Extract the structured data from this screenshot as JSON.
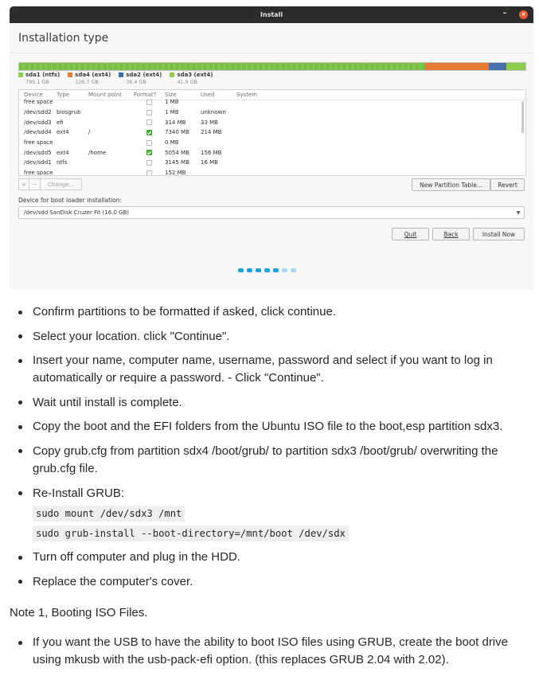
{
  "installer": {
    "window_title": "Install",
    "minimize_glyph": "–",
    "close_glyph": "×",
    "page_title": "Installation type",
    "usage_colors": {
      "green": "#77c043",
      "orange": "#e47c35",
      "blue": "#4a6fae",
      "lime": "#8ccd4c"
    },
    "legend": [
      {
        "name": "sda1 (ntfs)",
        "size": "795.1 GB",
        "color": "#8ccd4c"
      },
      {
        "name": "sda4 (ext4)",
        "size": "126.7 GB",
        "color": "#e47c35"
      },
      {
        "name": "sda2 (ext4)",
        "size": "36.4 GB",
        "color": "#3b6eb3"
      },
      {
        "name": "sda3 (ext4)",
        "size": "41.9 GB",
        "color": "#8ccd4c"
      }
    ],
    "columns": [
      "Device",
      "Type",
      "Mount point",
      "Format?",
      "Size",
      "Used",
      "System"
    ],
    "rows": [
      {
        "device": "free space",
        "type": "",
        "mount": "",
        "format": false,
        "size": "1 MB",
        "used": "",
        "system": ""
      },
      {
        "device": "/dev/sdd2",
        "type": "biosgrub",
        "mount": "",
        "format": false,
        "size": "1 MB",
        "used": "unknown",
        "system": ""
      },
      {
        "device": "/dev/sdd3",
        "type": "efi",
        "mount": "",
        "format": false,
        "size": "314 MB",
        "used": "33 MB",
        "system": ""
      },
      {
        "device": "/dev/sdd4",
        "type": "ext4",
        "mount": "/",
        "format": true,
        "size": "7340 MB",
        "used": "214 MB",
        "system": ""
      },
      {
        "device": "free space",
        "type": "",
        "mount": "",
        "format": false,
        "size": "0 MB",
        "used": "",
        "system": ""
      },
      {
        "device": "/dev/sdd5",
        "type": "ext4",
        "mount": "/home",
        "format": true,
        "size": "5054 MB",
        "used": "156 MB",
        "system": ""
      },
      {
        "device": "/dev/sdd1",
        "type": "ntfs",
        "mount": "",
        "format": false,
        "size": "3145 MB",
        "used": "16 MB",
        "system": ""
      },
      {
        "device": "free space",
        "type": "",
        "mount": "",
        "format": false,
        "size": "152 MB",
        "used": "",
        "system": ""
      }
    ],
    "toolbar": {
      "add": "+",
      "remove": "−",
      "change": "Change...",
      "new_table": "New Partition Table...",
      "revert": "Revert"
    },
    "boot_loader_label": "Device for boot loader installation:",
    "boot_loader_value": "/dev/sdd   SanDisk Cruzer Fit (16.0 GB)",
    "buttons": {
      "quit": "Quit",
      "back": "Back",
      "install_now": "Install Now"
    },
    "progress": {
      "total": 7,
      "current": 5,
      "active_color": "#19a2e0",
      "inactive_color": "#a8dbf2"
    }
  },
  "steps": [
    {
      "text": "Confirm partitions to be formatted if asked, click continue."
    },
    {
      "text": "Select your location. click \"Continue\"."
    },
    {
      "text": "Insert your name, computer name, username, password and select if you want to log in automatically or require a password. - Click \"Continue\"."
    },
    {
      "text": "Wait until install is complete."
    },
    {
      "text": "Copy the boot and the EFI folders from the Ubuntu ISO file to the boot,esp partition sdx3."
    },
    {
      "text": "Copy grub.cfg from partition sdx4 /boot/grub/ to partition sdx3 /boot/grub/ overwriting the grub.cfg file."
    },
    {
      "text": "Re-Install GRUB:",
      "code": [
        "sudo mount /dev/sdx3 /mnt",
        "sudo grub-install --boot-directory=/mnt/boot /dev/sdx"
      ]
    },
    {
      "text": "Turn off computer and plug in the HDD."
    },
    {
      "text": "Replace the computer's cover."
    }
  ],
  "note": "Note 1, Booting ISO Files.",
  "note_items": [
    {
      "text": "If you want the USB to have the ability to boot ISO files using GRUB, create the boot drive using mkusb with the usb-pack-efi option. (this replaces GRUB 2.04 with 2.02)."
    }
  ]
}
